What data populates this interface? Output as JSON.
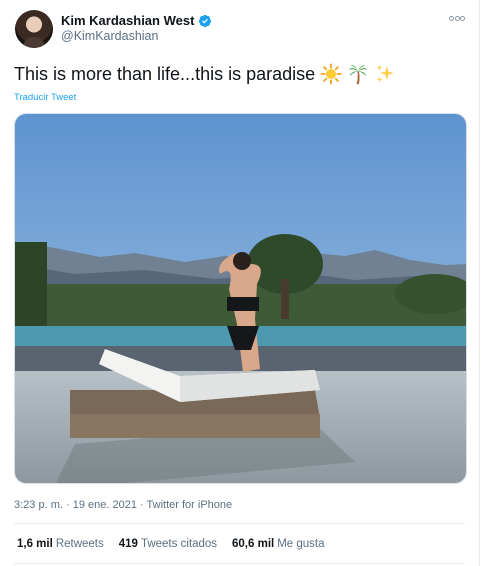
{
  "tweet": {
    "author": {
      "display_name": "Kim Kardashian West",
      "handle": "@KimKardashian",
      "verified": true
    },
    "text": "This is more than life...this is paradise",
    "emojis": [
      "sun-emoji",
      "palm-tree-emoji",
      "sparkles-emoji"
    ],
    "translate_label": "Traducir Tweet",
    "meta": {
      "time": "3:23 p. m.",
      "separator1": "·",
      "date": "19 ene. 2021",
      "separator2": "·",
      "source": "Twitter for iPhone"
    },
    "stats": [
      {
        "count": "1,6 mil",
        "label": "Retweets"
      },
      {
        "count": "419",
        "label": "Tweets citados"
      },
      {
        "count": "60,6 mil",
        "label": "Me gusta"
      }
    ]
  },
  "colors": {
    "accent": "#1da1f2",
    "secondary_text": "#5b7083",
    "primary_text": "#0f1419"
  }
}
